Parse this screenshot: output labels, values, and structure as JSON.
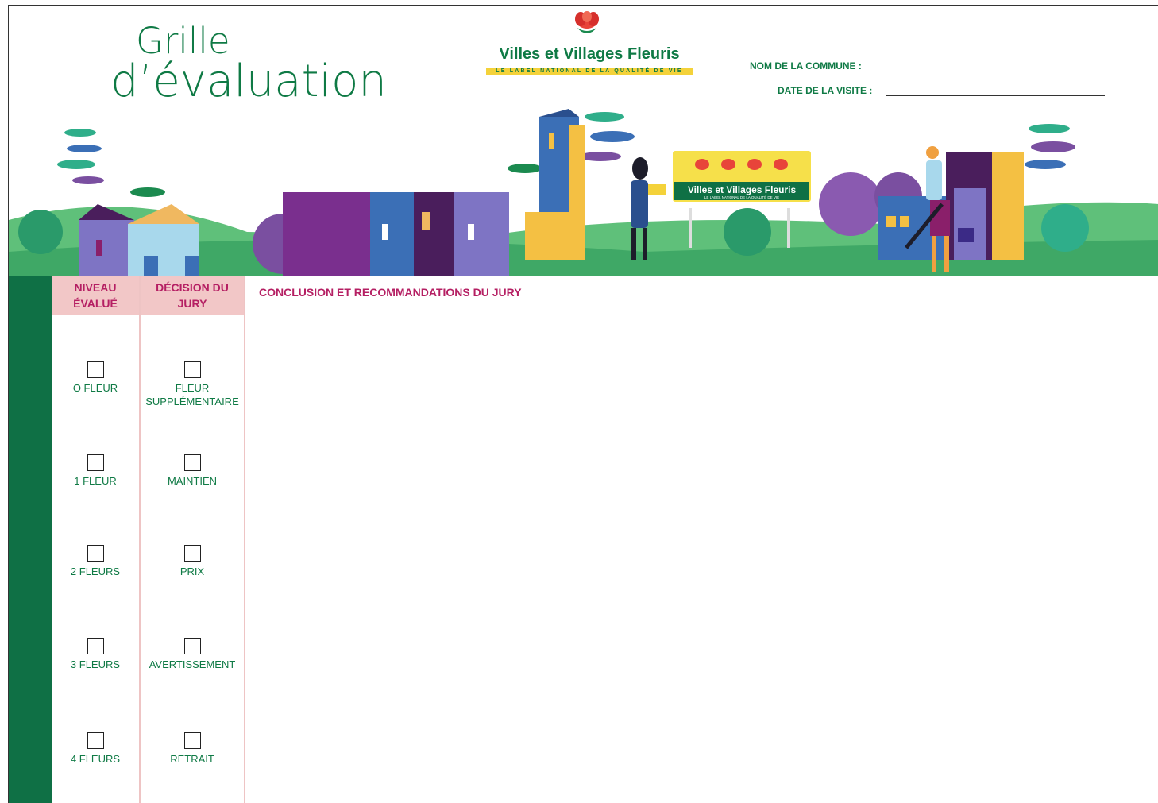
{
  "header": {
    "title_line1": "Grille",
    "title_line2": "d’évaluation",
    "logo_name": "Villes et Villages Fleuris",
    "logo_tagline": "LE LABEL NATIONAL DE LA QUALITÉ DE VIE",
    "commune_label": "NOM DE LA COMMUNE :",
    "date_label": "DATE DE LA VISITE :"
  },
  "illustration": {
    "sign_name": "Villes et Villages Fleuris",
    "sign_tagline": "LE LABEL NATIONAL DE LA QUALITÉ DE VIE",
    "sign_flower_count": 4
  },
  "columns": {
    "niveau_header": "NIVEAU ÉVALUÉ",
    "decision_header": "DÉCISION DU JURY"
  },
  "niveau_options": [
    "O FLEUR",
    "1 FLEUR",
    "2 FLEURS",
    "3 FLEURS",
    "4 FLEURS"
  ],
  "decision_options": [
    "FLEUR SUPPLÉMENTAIRE",
    "MAINTIEN",
    "PRIX",
    "AVERTISSEMENT",
    "RETRAIT"
  ],
  "conclusion": {
    "title": "CONCLUSION ET RECOMMANDATIONS DU JURY"
  },
  "colors": {
    "brand_green": "#0f7a45",
    "accent_magenta": "#b51f63",
    "header_pink": "#f2c7c7",
    "logo_yellow": "#f4d23a"
  }
}
